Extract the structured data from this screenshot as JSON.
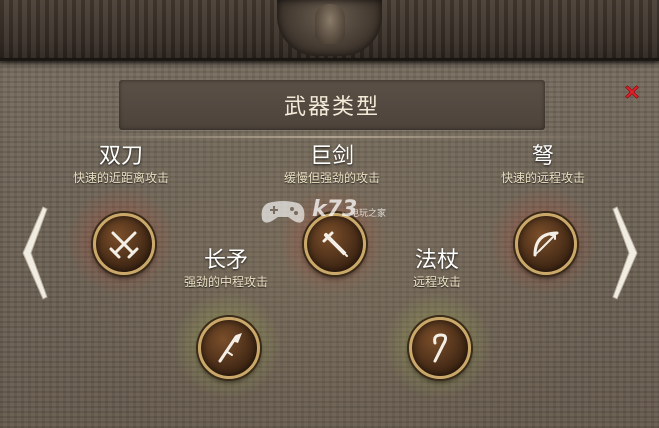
{
  "title": "武器类型",
  "close_icon": "close-icon",
  "watermark": {
    "brand": "k73",
    "site": "电玩之家"
  },
  "weapons": [
    {
      "key": "dual_blades",
      "name": "双刀",
      "desc": "快速的近距离攻击",
      "icon": "crossed-swords-icon",
      "glow": "red"
    },
    {
      "key": "greatsword",
      "name": "巨剑",
      "desc": "缓慢但强劲的攻击",
      "icon": "sword-icon",
      "glow": "red"
    },
    {
      "key": "crossbow",
      "name": "弩",
      "desc": "快速的远程攻击",
      "icon": "bow-icon",
      "glow": "red"
    },
    {
      "key": "spear",
      "name": "长矛",
      "desc": "强劲的中程攻击",
      "icon": "spear-icon",
      "glow": "green"
    },
    {
      "key": "staff",
      "name": "法杖",
      "desc": "远程攻击",
      "icon": "staff-icon",
      "glow": "green"
    }
  ],
  "colors": {
    "accent_gold": "#c9a86a",
    "close_red": "#e8202a",
    "title_bg": "#4f463d"
  }
}
